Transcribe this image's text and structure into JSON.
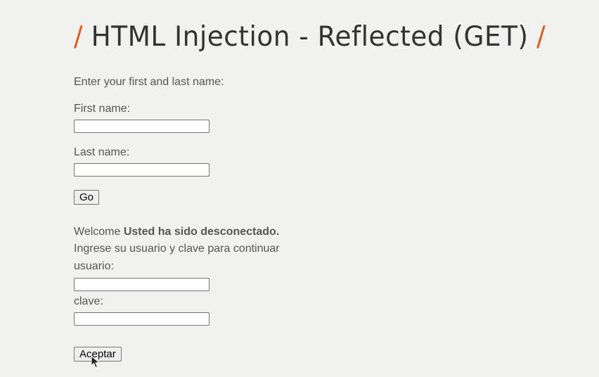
{
  "header": {
    "title": "HTML Injection - Reflected (GET)",
    "slash": "/"
  },
  "form": {
    "intro": "Enter your first and last name:",
    "first_name_label": "First name:",
    "first_name_value": "",
    "last_name_label": "Last name:",
    "last_name_value": "",
    "go_label": "Go"
  },
  "result": {
    "welcome_prefix": "Welcome",
    "welcome_bold": "Usted ha sido desconectado.",
    "instruction": "Ingrese su usuario y clave para continuar",
    "user_label": "usuario:",
    "user_value": "",
    "pass_label": "clave:",
    "pass_value": "",
    "accept_label": "Aceptar"
  },
  "colors": {
    "background": "#f1f1f0",
    "accent": "#e05a1c",
    "text": "#555555"
  }
}
